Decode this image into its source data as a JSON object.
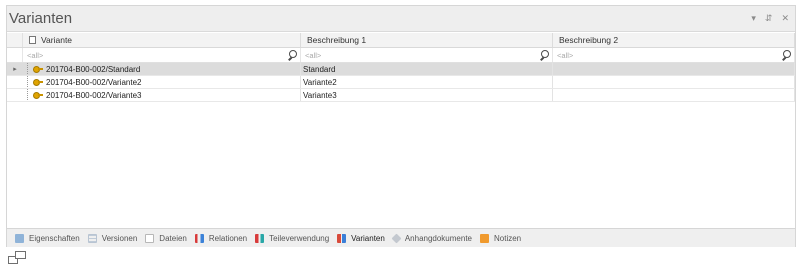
{
  "panel": {
    "title": "Varianten",
    "window_buttons": [
      "▾",
      "⇵",
      "✕"
    ]
  },
  "grid": {
    "columns": [
      "Variante",
      "Beschreibung 1",
      "Beschreibung 2"
    ],
    "filter_placeholder": "<all>",
    "rows": [
      {
        "variante": "201704-B00-002/Standard",
        "beschreibung1": "Standard",
        "beschreibung2": "",
        "selected": true
      },
      {
        "variante": "201704-B00-002/Variante2",
        "beschreibung1": "Variante2",
        "beschreibung2": "",
        "selected": false
      },
      {
        "variante": "201704-B00-002/Variante3",
        "beschreibung1": "Variante3",
        "beschreibung2": "",
        "selected": false
      }
    ],
    "row_marker": "▸"
  },
  "tabs": [
    {
      "label": "Eigenschaften",
      "icon": "properties-icon"
    },
    {
      "label": "Versionen",
      "icon": "versions-icon"
    },
    {
      "label": "Dateien",
      "icon": "files-icon"
    },
    {
      "label": "Relationen",
      "icon": "relations-icon"
    },
    {
      "label": "Teileverwendung",
      "icon": "usage-icon"
    },
    {
      "label": "Varianten",
      "icon": "variants-icon",
      "active": true
    },
    {
      "label": "Anhangdokumente",
      "icon": "attachment-icon"
    },
    {
      "label": "Notizen",
      "icon": "notes-icon"
    }
  ],
  "colors": {
    "titlebar_bg": "#eeeeee",
    "selected_row_bg": "#dcdcdc",
    "key_icon": "#e0a400"
  }
}
